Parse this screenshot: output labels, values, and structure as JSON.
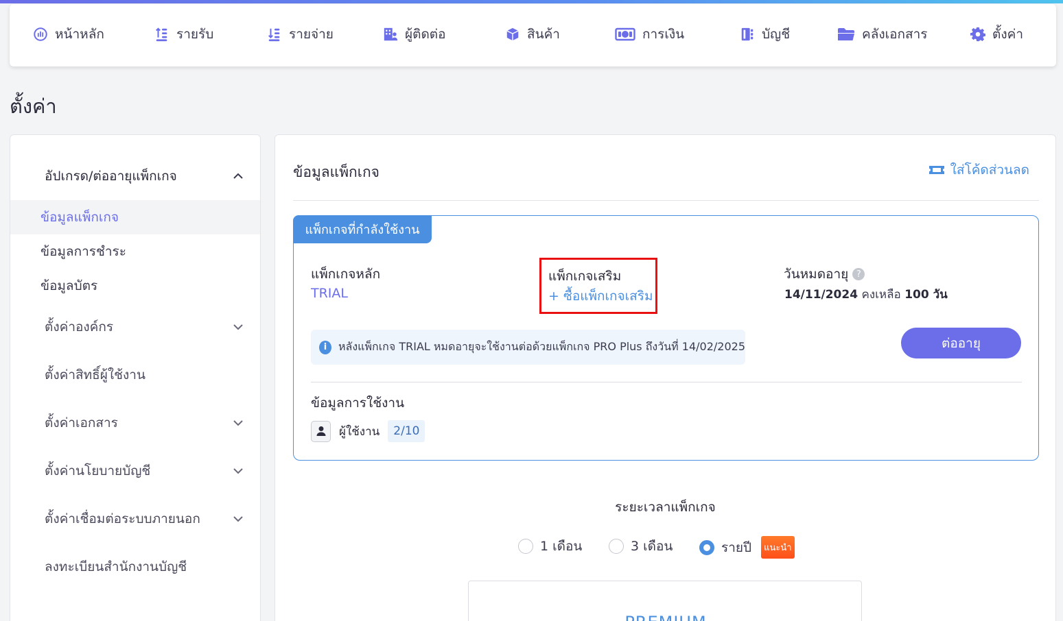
{
  "nav": {
    "items": [
      {
        "label": "หน้าหลัก",
        "icon": "dashboard-icon"
      },
      {
        "label": "รายรับ",
        "icon": "income-icon"
      },
      {
        "label": "รายจ่าย",
        "icon": "expense-icon"
      },
      {
        "label": "ผู้ติดต่อ",
        "icon": "contacts-icon"
      },
      {
        "label": "สินค้า",
        "icon": "product-box-icon"
      },
      {
        "label": "การเงิน",
        "icon": "money-icon"
      },
      {
        "label": "บัญชี",
        "icon": "ledger-icon"
      },
      {
        "label": "คลังเอกสาร",
        "icon": "folder-icon"
      },
      {
        "label": "ตั้งค่า",
        "icon": "gear-icon"
      }
    ]
  },
  "page_title": "ตั้งค่า",
  "sidebar": {
    "groups": [
      {
        "label": "อัปเกรด/ต่ออายุแพ็กเกจ",
        "expanded": true
      },
      {
        "label": "ตั้งค่าองค์กร",
        "expanded": false
      },
      {
        "label": "ตั้งค่าสิทธิ์ผู้ใช้งาน",
        "expanded": false
      },
      {
        "label": "ตั้งค่าเอกสาร",
        "expanded": false
      },
      {
        "label": "ตั้งค่านโยบายบัญชี",
        "expanded": false
      },
      {
        "label": "ตั้งค่าเชื่อมต่อระบบภายนอก",
        "expanded": false
      },
      {
        "label": "ลงทะเบียนสำนักงานบัญชี",
        "expanded": false
      }
    ],
    "sub_items": [
      {
        "label": "ข้อมูลแพ็กเกจ",
        "active": true
      },
      {
        "label": "ข้อมูลการชำระ",
        "active": false
      },
      {
        "label": "ข้อมูลบัตร",
        "active": false
      }
    ]
  },
  "main": {
    "title": "ข้อมูลแพ็กเกจ",
    "coupon_label": "ใส่โค้ดส่วนลด",
    "current_package": {
      "tag": "แพ็กเกจที่กำลังใช้งาน",
      "main_label": "แพ็กเกจหลัก",
      "main_value": "TRIAL",
      "addon_label": "แพ็กเกจเสริม",
      "addon_buy": "+ ซื้อแพ็กเกจเสริม",
      "expire_label": "วันหมดอายุ",
      "expire_date": "14/11/2024",
      "remaining_prefix": "คงเหลือ",
      "remaining_days": "100 วัน",
      "info_text": "หลังแพ็กเกจ TRIAL หมดอายุจะใช้งานต่อด้วยแพ็กเกจ PRO Plus ถึงวันที่ 14/02/2025",
      "renew_label": "ต่ออายุ",
      "usage_title": "ข้อมูลการใช้งาน",
      "users_label": "ผู้ใช้งาน",
      "users_value": "2/10"
    },
    "duration": {
      "title": "ระยะเวลาแพ็กเกจ",
      "options": [
        {
          "label": "1 เดือน",
          "checked": false
        },
        {
          "label": "3 เดือน",
          "checked": false
        },
        {
          "label": "รายปี",
          "checked": true
        }
      ],
      "recommend_badge": "แนะนำ"
    },
    "plan_name": "PREMIUM"
  },
  "colors": {
    "primary": "#6b6ee8",
    "link": "#4a8fe0",
    "highlight_border": "#e81010",
    "badge_orange": "#ff5a1f"
  }
}
